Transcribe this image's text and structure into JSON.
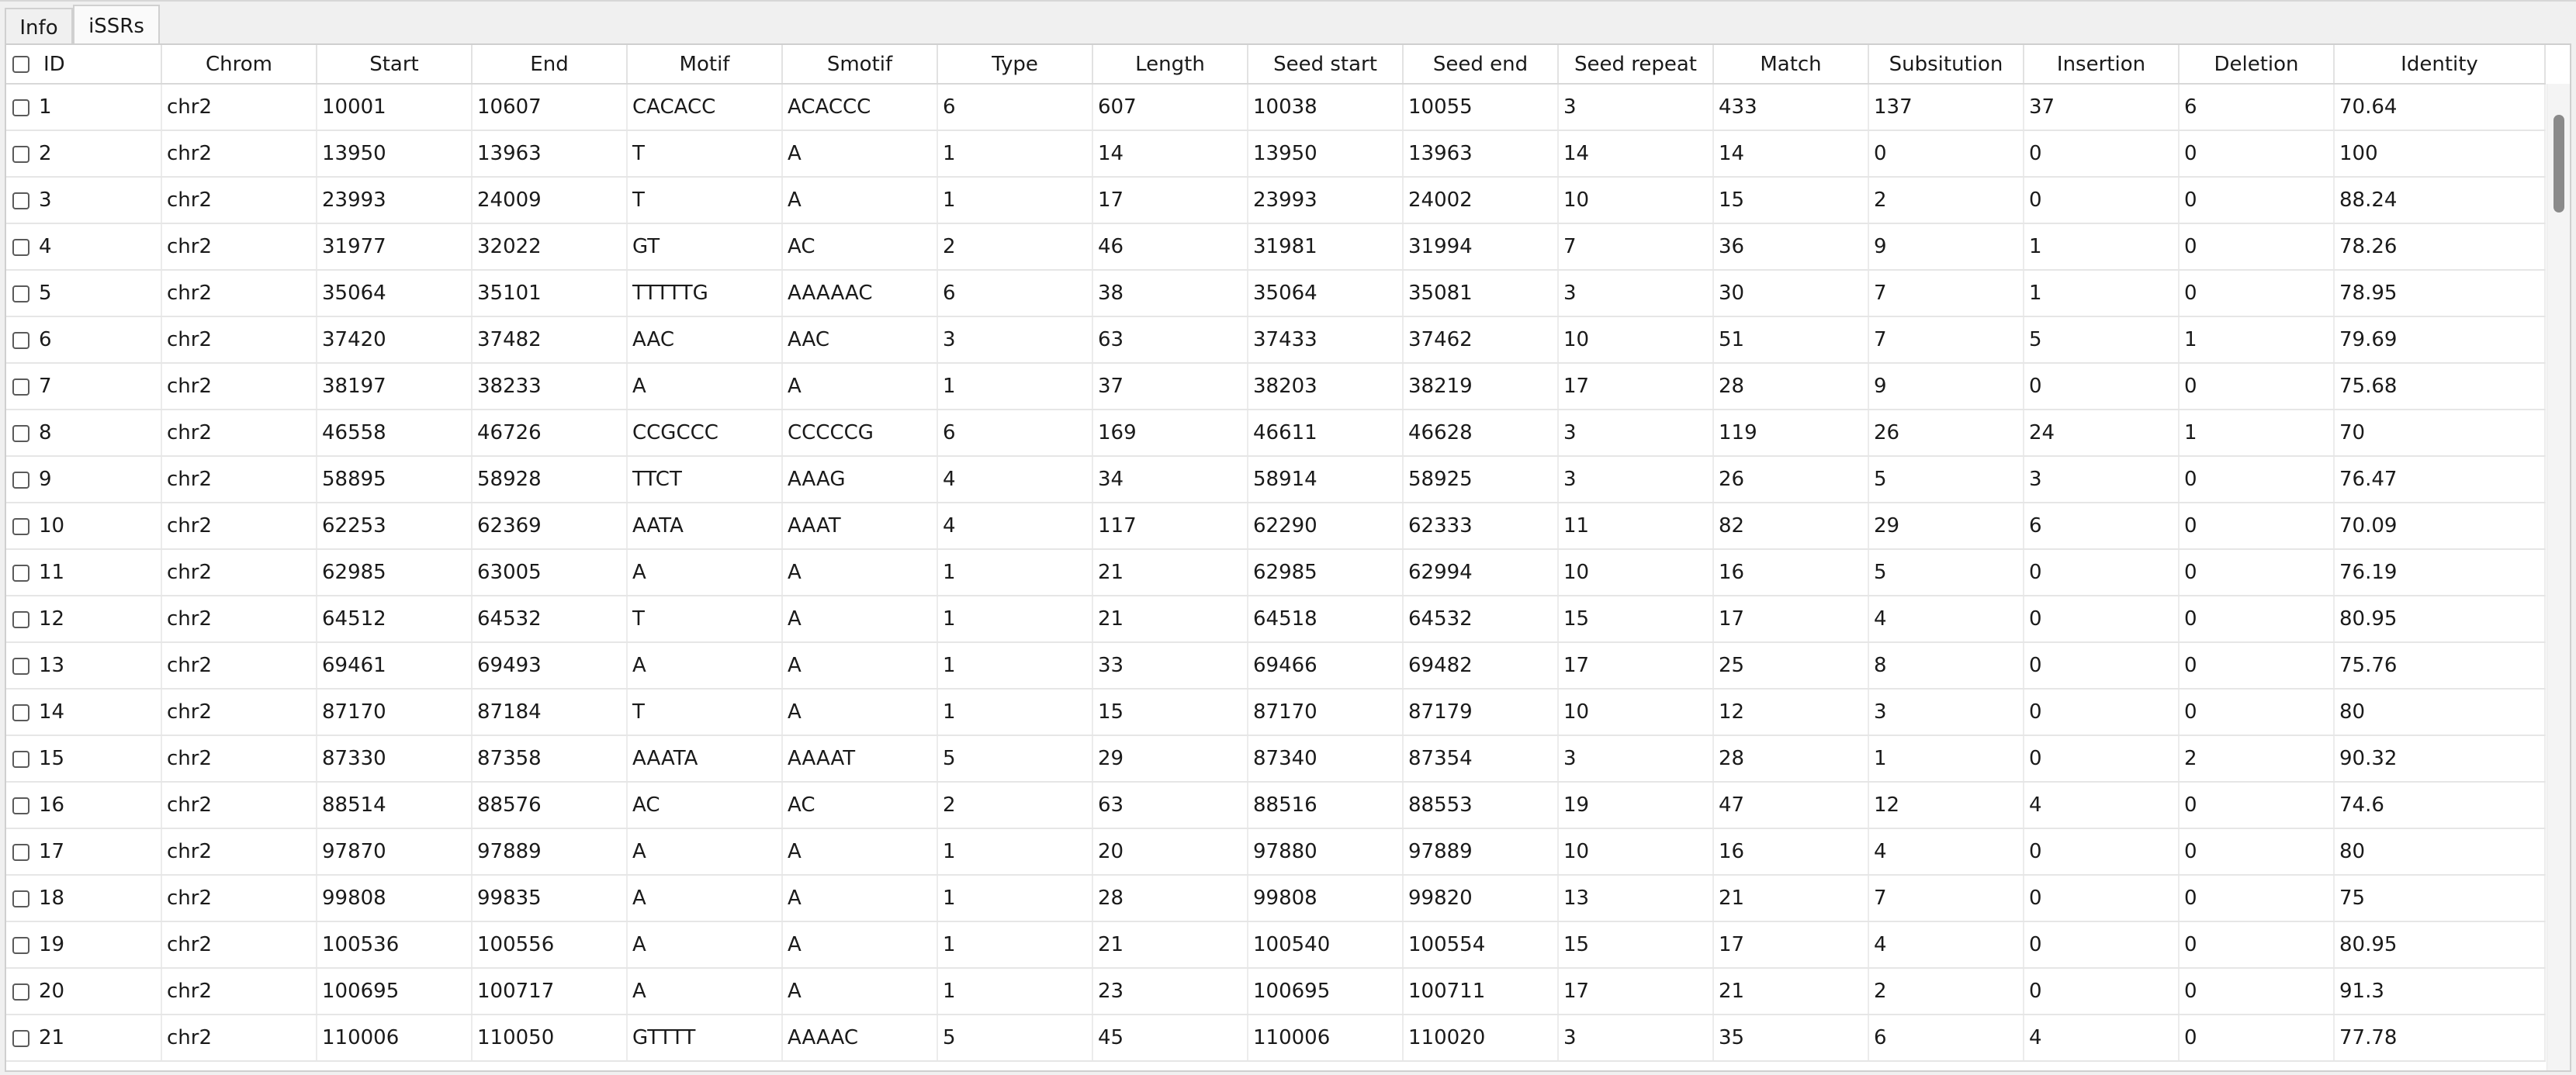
{
  "tabs": [
    {
      "label": "Info",
      "active": false
    },
    {
      "label": "iSSRs",
      "active": true
    }
  ],
  "table": {
    "columns": [
      "ID",
      "Chrom",
      "Start",
      "End",
      "Motif",
      "Smotif",
      "Type",
      "Length",
      "Seed start",
      "Seed end",
      "Seed repeat",
      "Match",
      "Subsitution",
      "Insertion",
      "Deletion",
      "Identity"
    ],
    "rows": [
      [
        "1",
        "chr2",
        "10001",
        "10607",
        "CACACC",
        "ACACCC",
        "6",
        "607",
        "10038",
        "10055",
        "3",
        "433",
        "137",
        "37",
        "6",
        "70.64"
      ],
      [
        "2",
        "chr2",
        "13950",
        "13963",
        "T",
        "A",
        "1",
        "14",
        "13950",
        "13963",
        "14",
        "14",
        "0",
        "0",
        "0",
        "100"
      ],
      [
        "3",
        "chr2",
        "23993",
        "24009",
        "T",
        "A",
        "1",
        "17",
        "23993",
        "24002",
        "10",
        "15",
        "2",
        "0",
        "0",
        "88.24"
      ],
      [
        "4",
        "chr2",
        "31977",
        "32022",
        "GT",
        "AC",
        "2",
        "46",
        "31981",
        "31994",
        "7",
        "36",
        "9",
        "1",
        "0",
        "78.26"
      ],
      [
        "5",
        "chr2",
        "35064",
        "35101",
        "TTTTTG",
        "AAAAAC",
        "6",
        "38",
        "35064",
        "35081",
        "3",
        "30",
        "7",
        "1",
        "0",
        "78.95"
      ],
      [
        "6",
        "chr2",
        "37420",
        "37482",
        "AAC",
        "AAC",
        "3",
        "63",
        "37433",
        "37462",
        "10",
        "51",
        "7",
        "5",
        "1",
        "79.69"
      ],
      [
        "7",
        "chr2",
        "38197",
        "38233",
        "A",
        "A",
        "1",
        "37",
        "38203",
        "38219",
        "17",
        "28",
        "9",
        "0",
        "0",
        "75.68"
      ],
      [
        "8",
        "chr2",
        "46558",
        "46726",
        "CCGCCC",
        "CCCCCG",
        "6",
        "169",
        "46611",
        "46628",
        "3",
        "119",
        "26",
        "24",
        "1",
        "70"
      ],
      [
        "9",
        "chr2",
        "58895",
        "58928",
        "TTCT",
        "AAAG",
        "4",
        "34",
        "58914",
        "58925",
        "3",
        "26",
        "5",
        "3",
        "0",
        "76.47"
      ],
      [
        "10",
        "chr2",
        "62253",
        "62369",
        "AATA",
        "AAAT",
        "4",
        "117",
        "62290",
        "62333",
        "11",
        "82",
        "29",
        "6",
        "0",
        "70.09"
      ],
      [
        "11",
        "chr2",
        "62985",
        "63005",
        "A",
        "A",
        "1",
        "21",
        "62985",
        "62994",
        "10",
        "16",
        "5",
        "0",
        "0",
        "76.19"
      ],
      [
        "12",
        "chr2",
        "64512",
        "64532",
        "T",
        "A",
        "1",
        "21",
        "64518",
        "64532",
        "15",
        "17",
        "4",
        "0",
        "0",
        "80.95"
      ],
      [
        "13",
        "chr2",
        "69461",
        "69493",
        "A",
        "A",
        "1",
        "33",
        "69466",
        "69482",
        "17",
        "25",
        "8",
        "0",
        "0",
        "75.76"
      ],
      [
        "14",
        "chr2",
        "87170",
        "87184",
        "T",
        "A",
        "1",
        "15",
        "87170",
        "87179",
        "10",
        "12",
        "3",
        "0",
        "0",
        "80"
      ],
      [
        "15",
        "chr2",
        "87330",
        "87358",
        "AAATA",
        "AAAAT",
        "5",
        "29",
        "87340",
        "87354",
        "3",
        "28",
        "1",
        "0",
        "2",
        "90.32"
      ],
      [
        "16",
        "chr2",
        "88514",
        "88576",
        "AC",
        "AC",
        "2",
        "63",
        "88516",
        "88553",
        "19",
        "47",
        "12",
        "4",
        "0",
        "74.6"
      ],
      [
        "17",
        "chr2",
        "97870",
        "97889",
        "A",
        "A",
        "1",
        "20",
        "97880",
        "97889",
        "10",
        "16",
        "4",
        "0",
        "0",
        "80"
      ],
      [
        "18",
        "chr2",
        "99808",
        "99835",
        "A",
        "A",
        "1",
        "28",
        "99808",
        "99820",
        "13",
        "21",
        "7",
        "0",
        "0",
        "75"
      ],
      [
        "19",
        "chr2",
        "100536",
        "100556",
        "A",
        "A",
        "1",
        "21",
        "100540",
        "100554",
        "15",
        "17",
        "4",
        "0",
        "0",
        "80.95"
      ],
      [
        "20",
        "chr2",
        "100695",
        "100717",
        "A",
        "A",
        "1",
        "23",
        "100695",
        "100711",
        "17",
        "21",
        "2",
        "0",
        "0",
        "91.3"
      ],
      [
        "21",
        "chr2",
        "110006",
        "110050",
        "GTTTT",
        "AAAAC",
        "5",
        "45",
        "110006",
        "110020",
        "3",
        "35",
        "6",
        "4",
        "0",
        "77.78"
      ]
    ]
  },
  "scrollbar": {
    "position_fraction": 0.0
  }
}
